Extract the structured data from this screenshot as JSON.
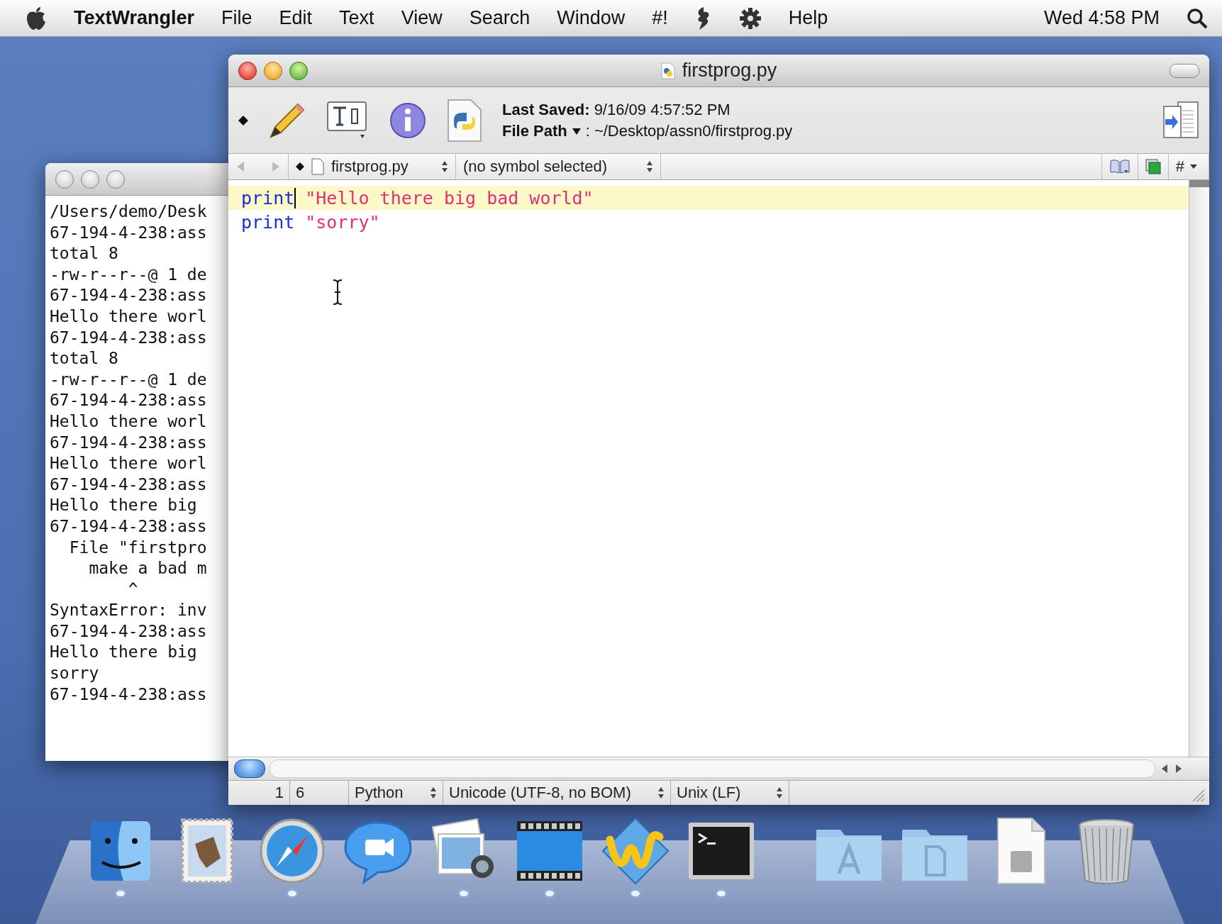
{
  "menubar": {
    "items": [
      {
        "kind": "apple"
      },
      {
        "kind": "app",
        "label": "TextWrangler"
      },
      {
        "kind": "menu",
        "label": "File"
      },
      {
        "kind": "menu",
        "label": "Edit"
      },
      {
        "kind": "menu",
        "label": "Text"
      },
      {
        "kind": "menu",
        "label": "View"
      },
      {
        "kind": "menu",
        "label": "Search"
      },
      {
        "kind": "menu",
        "label": "Window"
      },
      {
        "kind": "menu",
        "label": "#!"
      },
      {
        "kind": "script"
      },
      {
        "kind": "gear"
      },
      {
        "kind": "menu",
        "label": "Help"
      }
    ],
    "clock": "Wed 4:58 PM"
  },
  "terminal": {
    "active": false,
    "lines": [
      "/Users/demo/Desk",
      "67-194-4-238:ass",
      "total 8",
      "-rw-r--r--@ 1 de",
      "67-194-4-238:ass",
      "Hello there worl",
      "67-194-4-238:ass",
      "total 8",
      "-rw-r--r--@ 1 de",
      "67-194-4-238:ass",
      "Hello there worl",
      "67-194-4-238:ass",
      "Hello there worl",
      "67-194-4-238:ass",
      "Hello there big",
      "67-194-4-238:ass",
      "  File \"firstpro",
      "    make a bad m",
      "        ^",
      "SyntaxError: inv",
      "67-194-4-238:ass",
      "Hello there big",
      "sorry",
      "67-194-4-238:ass"
    ]
  },
  "editor": {
    "active": true,
    "title": "firstprog.py",
    "last_saved_label": "Last Saved:",
    "last_saved": "9/16/09 4:57:52 PM",
    "file_path_label": "File Path",
    "file_path": ": ~/Desktop/assn0/firstprog.py",
    "file_menu": "firstprog.py",
    "symbol_menu": "(no symbol selected)",
    "counterpart_menu": "#",
    "lines": [
      {
        "current": true,
        "tokens": [
          {
            "kind": "keyword",
            "text": "print",
            "caret": true
          },
          {
            "kind": "string",
            "text": "\"Hello there big bad world\"",
            "caret": false
          }
        ]
      },
      {
        "current": false,
        "tokens": [
          {
            "kind": "keyword",
            "text": "print",
            "caret": false
          },
          {
            "kind": "string",
            "text": "\"sorry\"",
            "caret": false
          }
        ]
      }
    ],
    "status": {
      "line": "1",
      "column": "6",
      "language": "Python",
      "encoding": "Unicode (UTF-8, no BOM)",
      "line_endings": "Unix (LF)"
    }
  },
  "dock": {
    "apps": [
      {
        "kind": "finder",
        "running": true
      },
      {
        "kind": "mail",
        "running": false
      },
      {
        "kind": "safari",
        "running": true
      },
      {
        "kind": "ichat",
        "running": false
      },
      {
        "kind": "iphoto",
        "running": true
      },
      {
        "kind": "imovie",
        "running": true
      },
      {
        "kind": "textwrangler",
        "running": true
      },
      {
        "kind": "terminal",
        "running": true
      }
    ],
    "docs": [
      {
        "kind": "apps_folder",
        "running": false
      },
      {
        "kind": "docs_folder",
        "running": false
      },
      {
        "kind": "file",
        "running": false
      },
      {
        "kind": "trash",
        "running": false
      }
    ]
  }
}
